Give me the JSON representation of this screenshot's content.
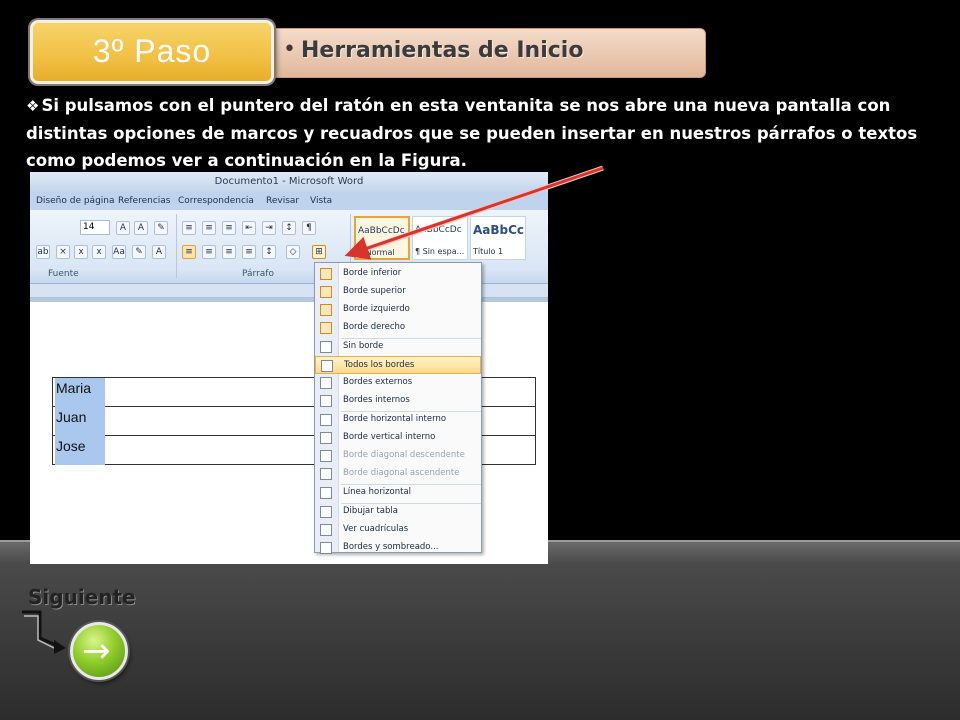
{
  "header": {
    "step_label": "3º  Paso",
    "title": "Herramientas de Inicio",
    "bullet": "•"
  },
  "description": {
    "bullet_glyph": "❖",
    "text": "Si pulsamos con el puntero del ratón en esta ventanita se nos abre una nueva pantalla con distintas opciones de marcos y recuadros que se pueden insertar en nuestros párrafos o textos como podemos ver a continuación en la Figura."
  },
  "word": {
    "window_title": "Documento1 - Microsoft Word",
    "tabs": [
      "Diseño de página",
      "Referencias",
      "Correspondencia",
      "Revisar",
      "Vista"
    ],
    "font_size": "14",
    "groups": [
      "Fuente",
      "Párrafo"
    ],
    "styles": [
      {
        "sample": "AaBbCcDc",
        "name": "¶ Normal",
        "selected": true
      },
      {
        "sample": "AaBbCcDc",
        "name": "¶ Sin espa...",
        "selected": false
      },
      {
        "sample": "AaBbCc",
        "name": "Título 1",
        "selected": false
      }
    ],
    "table_rows": [
      "Maria",
      "Juan",
      "Jose"
    ]
  },
  "borders_menu": {
    "items": [
      {
        "label": "Borde inferior",
        "state": "enabled",
        "icon": "border-bottom-icon"
      },
      {
        "label": "Borde superior",
        "state": "enabled",
        "icon": "border-top-icon"
      },
      {
        "label": "Borde izquierdo",
        "state": "enabled",
        "icon": "border-left-icon"
      },
      {
        "label": "Borde derecho",
        "state": "enabled",
        "icon": "border-right-icon"
      },
      {
        "label": "Sin borde",
        "state": "enabled",
        "icon": "no-border-icon"
      },
      {
        "label": "Todos los bordes",
        "state": "active",
        "icon": "all-borders-icon"
      },
      {
        "label": "Bordes externos",
        "state": "enabled",
        "icon": "outside-borders-icon"
      },
      {
        "label": "Bordes internos",
        "state": "enabled",
        "icon": "inside-borders-icon"
      },
      {
        "label": "Borde horizontal interno",
        "state": "enabled",
        "icon": "inside-horizontal-border-icon"
      },
      {
        "label": "Borde vertical interno",
        "state": "enabled",
        "icon": "inside-vertical-border-icon"
      },
      {
        "label": "Borde diagonal descendente",
        "state": "disabled",
        "icon": "diagonal-down-border-icon"
      },
      {
        "label": "Borde diagonal ascendente",
        "state": "disabled",
        "icon": "diagonal-up-border-icon"
      },
      {
        "label": "Línea horizontal",
        "state": "enabled",
        "icon": "horizontal-line-icon"
      },
      {
        "label": "Dibujar tabla",
        "state": "enabled",
        "icon": "draw-table-icon"
      },
      {
        "label": "Ver cuadrículas",
        "state": "enabled",
        "icon": "view-gridlines-icon"
      },
      {
        "label": "Bordes y sombreado...",
        "state": "enabled",
        "icon": "borders-shading-icon"
      }
    ]
  },
  "footer": {
    "next_label": "Siguiente",
    "next_icon": "→"
  },
  "colors": {
    "step_badge": "#f1c044",
    "header_bar": "#e2b79a",
    "pointer_arrow": "#d9342b",
    "next_button": "#8fcc2a"
  }
}
